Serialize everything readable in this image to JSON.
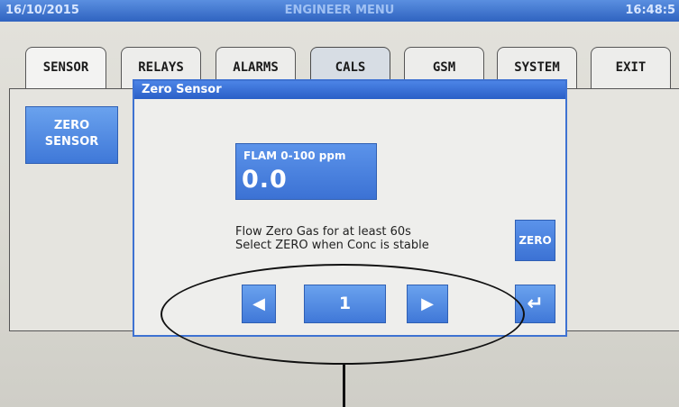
{
  "status_bar": {
    "date": "16/10/2015",
    "title": "ENGINEER MENU",
    "time": "16:48:5"
  },
  "tabs": [
    {
      "label": "SENSOR"
    },
    {
      "label": "RELAYS"
    },
    {
      "label": "ALARMS"
    },
    {
      "label": "CALS"
    },
    {
      "label": "GSM"
    },
    {
      "label": "SYSTEM"
    },
    {
      "label": "EXIT"
    }
  ],
  "side_button": {
    "line1": "ZERO",
    "line2": "SENSOR"
  },
  "dialog": {
    "title": "Zero Sensor",
    "readout_label": "FLAM  0-100 ppm",
    "readout_value": "0.0",
    "instruction_line1": "Flow Zero Gas for at least 60s",
    "instruction_line2": "Select ZERO when Conc is stable",
    "zero_label": "ZERO",
    "prev_icon": "left-arrow-icon",
    "next_icon": "right-arrow-icon",
    "enter_icon": "enter-return-icon",
    "page_value": "1"
  },
  "colors": {
    "accent_blue": "#3c72d4",
    "status_bar": "#2f63c0",
    "background": "#dcdcd6"
  }
}
